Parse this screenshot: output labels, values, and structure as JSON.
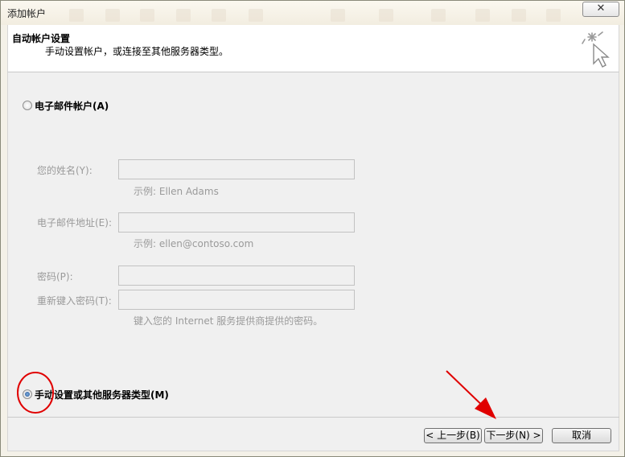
{
  "window": {
    "title": "添加帐户",
    "close_glyph": "✕"
  },
  "header": {
    "title": "自动帐户设置",
    "subtitle": "手动设置帐户，或连接至其他服务器类型。"
  },
  "options": {
    "email_account": {
      "label": "电子邮件帐户(A)",
      "selected": false
    },
    "manual_setup": {
      "label": "手动设置或其他服务器类型(M)",
      "selected": true
    }
  },
  "form": {
    "name": {
      "label": "您的姓名(Y):",
      "value": "",
      "hint": "示例: Ellen Adams"
    },
    "email": {
      "label": "电子邮件地址(E):",
      "value": "",
      "hint": "示例: ellen@contoso.com"
    },
    "password": {
      "label": "密码(P):",
      "value": ""
    },
    "retype_password": {
      "label": "重新键入密码(T):",
      "value": "",
      "hint": "键入您的 Internet 服务提供商提供的密码。"
    }
  },
  "buttons": {
    "back": "< 上一步(B)",
    "next": "下一步(N) >",
    "cancel": "取消"
  },
  "colors": {
    "annotation_red": "#e00000",
    "radio_selected": "#1f4e92"
  }
}
